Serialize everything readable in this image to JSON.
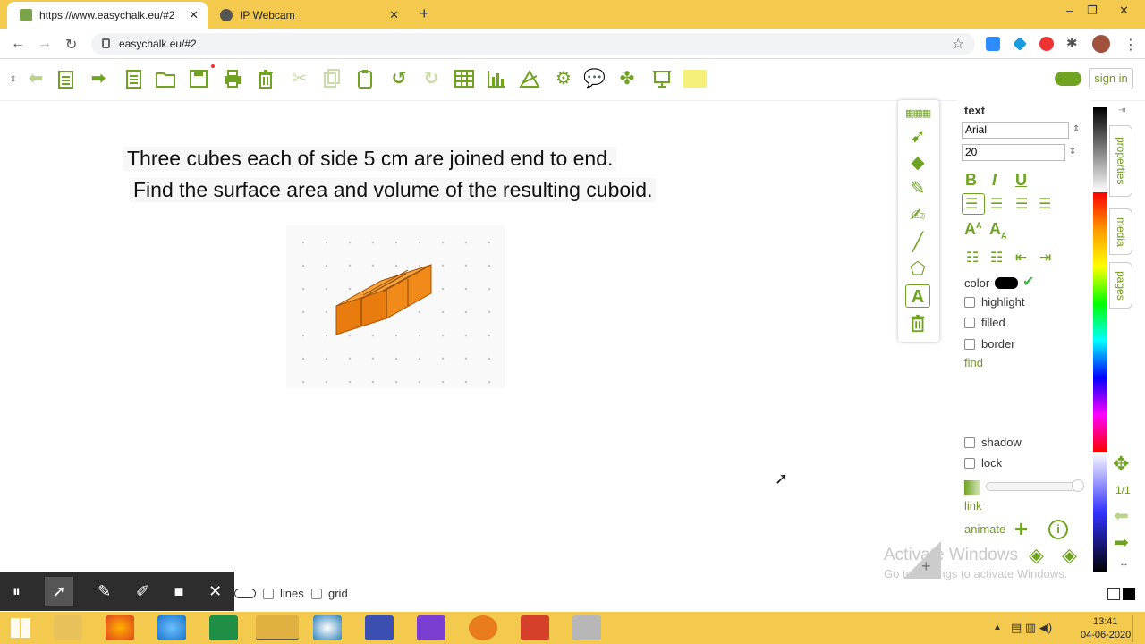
{
  "browser": {
    "tabs": [
      {
        "title": "https://www.easychalk.eu/#2",
        "active": true
      },
      {
        "title": "IP Webcam",
        "active": false
      }
    ],
    "new_tab": "+",
    "window_controls": {
      "minimize": "–",
      "restore": "❐",
      "close": "✕"
    },
    "nav": {
      "back": "←",
      "forward": "→",
      "reload": "↻"
    },
    "url": "easychalk.eu/#2",
    "star": "☆",
    "menu": "⋮"
  },
  "app": {
    "signin_label": "sign in",
    "question_line1": "Three cubes each of side 5 cm are joined end to end.",
    "question_line2": "Find the surface area and volume of the resulting cuboid.",
    "accent_color": "#6fa321",
    "cube_color": "#f07e10"
  },
  "properties": {
    "section_title": "text",
    "font": "Arial",
    "size": "20",
    "bold": "B",
    "italic": "I",
    "underline": "U",
    "superscript": "A",
    "subscript": "A",
    "color_label": "color",
    "current_color": "#000000",
    "highlight_label": "highlight",
    "filled_label": "filled",
    "border_label": "border",
    "find_label": "find",
    "shadow_label": "shadow",
    "lock_label": "lock",
    "link_label": "link",
    "animate_label": "animate",
    "opacity": 1
  },
  "side_tabs": {
    "properties": "properties",
    "media": "media",
    "pages": "pages"
  },
  "page_indicator": "1/1",
  "bottom": {
    "lines_label": "lines",
    "grid_label": "grid"
  },
  "watermark": {
    "line1": "Activate Windows",
    "line2": "Go to Settings to activate Windows."
  },
  "taskbar": {
    "time": "13:41",
    "date": "04-06-2020"
  }
}
